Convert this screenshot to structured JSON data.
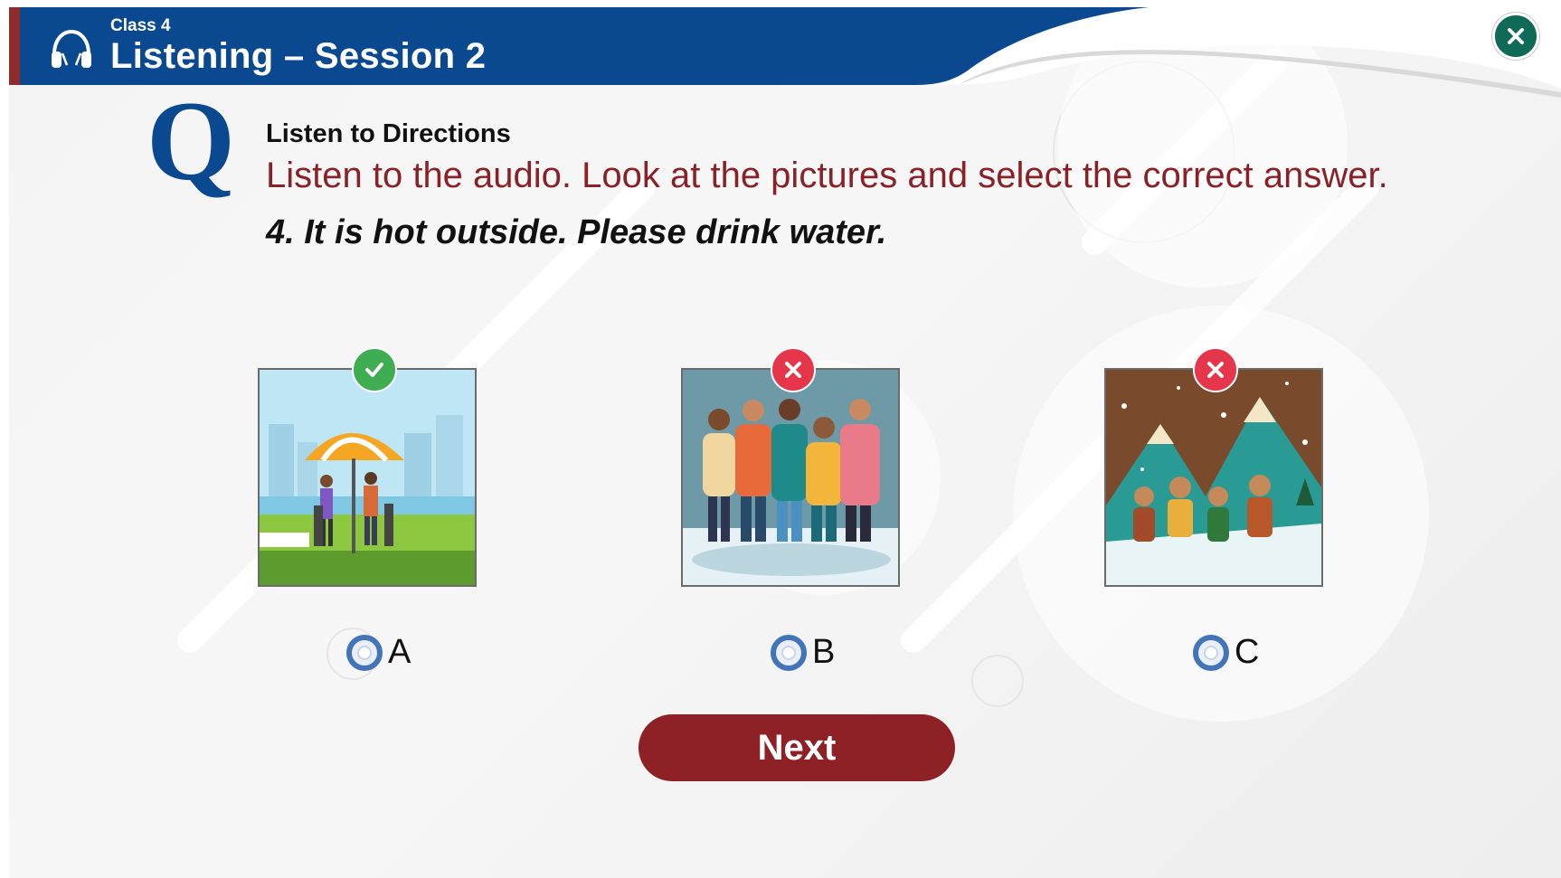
{
  "header": {
    "class_label": "Class 4",
    "session_title": "Listening – Session 2",
    "close_icon": "close-icon",
    "headphones_icon": "headphones-icon"
  },
  "question": {
    "letter": "Q",
    "directions_title": "Listen to Directions",
    "instruction": "Listen to the audio. Look at the pictures and select the correct answer.",
    "prompt": "4. It is hot outside. Please drink water."
  },
  "options": [
    {
      "label": "A",
      "picture": "people under a beach umbrella in a sunny park",
      "status": "correct",
      "status_icon": "check-icon"
    },
    {
      "label": "B",
      "picture": "group of people in warm winter clothing",
      "status": "wrong",
      "status_icon": "cross-icon"
    },
    {
      "label": "C",
      "picture": "children walking in snowy mountains",
      "status": "wrong",
      "status_icon": "cross-icon"
    }
  ],
  "actions": {
    "next_label": "Next"
  },
  "colors": {
    "header_blue": "#0a4990",
    "instruction_red": "#8a2126",
    "next_button": "#8d2126",
    "correct_green": "#3fae52",
    "wrong_red": "#e5364b",
    "radio_blue": "#4274b7"
  }
}
